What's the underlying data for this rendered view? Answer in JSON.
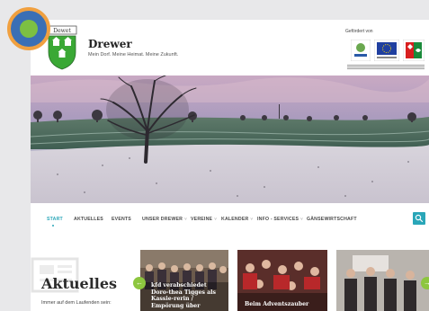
{
  "header": {
    "crest_text": "Dewet",
    "site_title": "Drewer",
    "tagline": "Mein Dorf. Meine Heimat. Meine Zukunft.",
    "funding_label": "Gefördert von"
  },
  "nav": {
    "items": [
      {
        "label": "START",
        "dropdown": false
      },
      {
        "label": "AKTUELLES",
        "dropdown": false
      },
      {
        "label": "EVENTS",
        "dropdown": false
      },
      {
        "label": "UNSER DREWER",
        "dropdown": true
      },
      {
        "label": "VEREINE",
        "dropdown": true
      },
      {
        "label": "KALENDER",
        "dropdown": true
      },
      {
        "label": "INFO - SERVICES",
        "dropdown": true
      },
      {
        "label": "GÄNSEWIRTSCHAFT",
        "dropdown": false
      }
    ],
    "dropdown_glyph": "˅",
    "search_icon": "search-icon"
  },
  "news": {
    "heading": "Aktuelles",
    "subtext": "Immer auf dem Laufenden sein:",
    "cards": [
      {
        "title": "kfd verabschiedet Doro-thea Tigges als Kassie-rerin / Empörung über"
      },
      {
        "title": "Beim Adventszauber"
      },
      {
        "title": ""
      }
    ],
    "prev_glyph": "←",
    "next_glyph": "→"
  },
  "colors": {
    "accent": "#2aa6b8",
    "arrow": "#8dc63f",
    "overlay_blue": "#3a6fb5",
    "overlay_ring": "#f0a040",
    "overlay_center": "#7cc043"
  }
}
